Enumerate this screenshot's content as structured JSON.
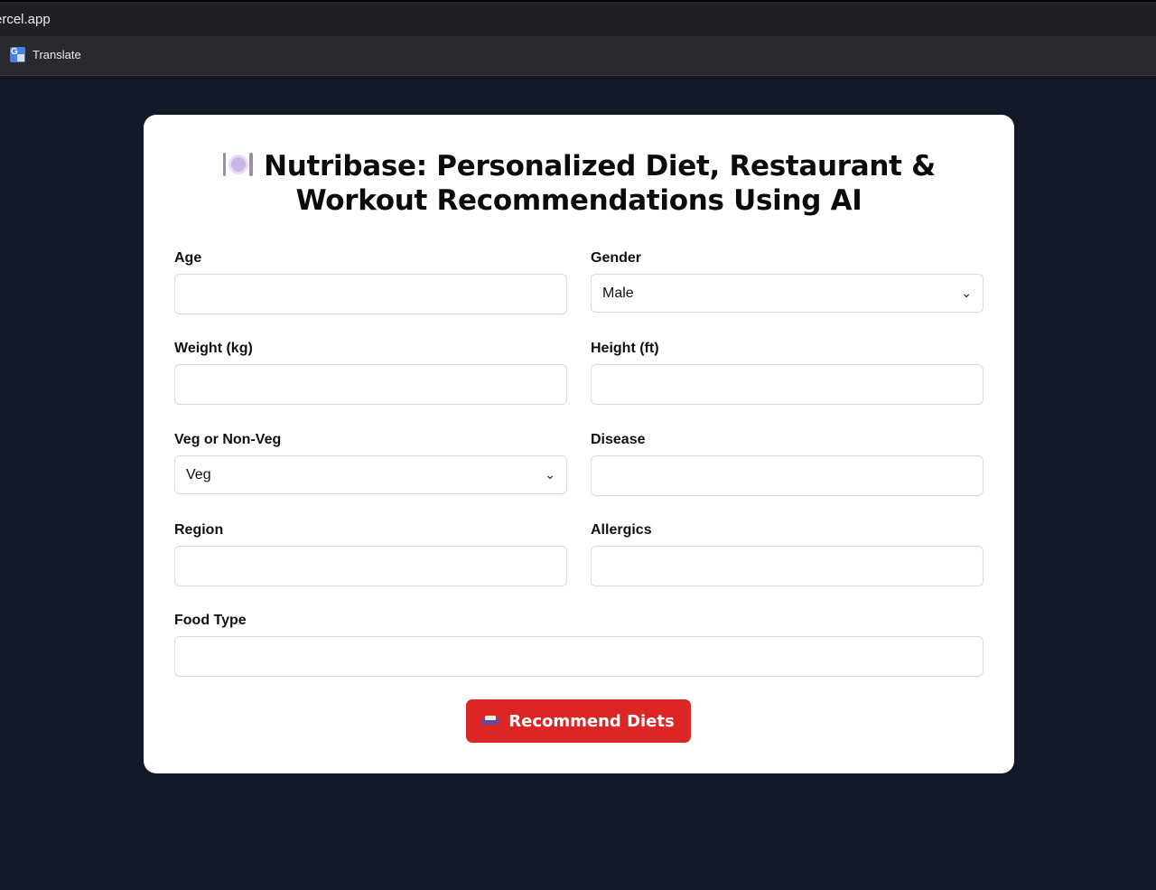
{
  "browser": {
    "url_text": "ercel.app",
    "bookmark_label": "Translate"
  },
  "app": {
    "title": "Nutribase: Personalized Diet, Restaurant & Workout Recommendations Using AI"
  },
  "form": {
    "age_label": "Age",
    "age_value": "",
    "gender_label": "Gender",
    "gender_value": "Male",
    "weight_label": "Weight (kg)",
    "weight_value": "",
    "height_label": "Height (ft)",
    "height_value": "",
    "diet_label": "Veg or Non-Veg",
    "diet_value": "Veg",
    "disease_label": "Disease",
    "disease_value": "",
    "region_label": "Region",
    "region_value": "",
    "allergics_label": "Allergics",
    "allergics_value": "",
    "food_type_label": "Food Type",
    "food_type_value": ""
  },
  "button": {
    "label": "Recommend Diets"
  },
  "icons": {
    "title_icon": "plate-with-cutlery-icon",
    "button_icon": "book-icon",
    "bookmark_icon": "translate-icon"
  },
  "colors": {
    "background": "#121827",
    "card": "#ffffff",
    "button": "#dc2626"
  }
}
